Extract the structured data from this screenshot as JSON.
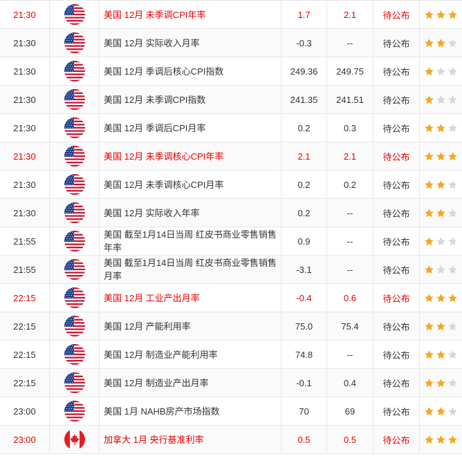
{
  "colors": {
    "important": "#e60000",
    "normal": "#333333",
    "star_on": "#f5a623",
    "star_off": "#d7d7d7"
  },
  "rows": [
    {
      "time": "21:30",
      "country": "us",
      "flag_icon": "us-flag-icon",
      "event": "美国 12月 未季调CPI年率",
      "previous": "1.7",
      "forecast": "2.1",
      "actual": "待公布",
      "stars": 3,
      "important": true
    },
    {
      "time": "21:30",
      "country": "us",
      "flag_icon": "us-flag-icon",
      "event": "美国 12月 实际收入月率",
      "previous": "-0.3",
      "forecast": "--",
      "actual": "待公布",
      "stars": 2,
      "important": false
    },
    {
      "time": "21:30",
      "country": "us",
      "flag_icon": "us-flag-icon",
      "event": "美国 12月 季调后核心CPI指数",
      "previous": "249.36",
      "forecast": "249.75",
      "actual": "待公布",
      "stars": 1,
      "important": false
    },
    {
      "time": "21:30",
      "country": "us",
      "flag_icon": "us-flag-icon",
      "event": "美国 12月 未季调CPI指数",
      "previous": "241.35",
      "forecast": "241.51",
      "actual": "待公布",
      "stars": 1,
      "important": false
    },
    {
      "time": "21:30",
      "country": "us",
      "flag_icon": "us-flag-icon",
      "event": "美国 12月 季调后CPI月率",
      "previous": "0.2",
      "forecast": "0.3",
      "actual": "待公布",
      "stars": 2,
      "important": false
    },
    {
      "time": "21:30",
      "country": "us",
      "flag_icon": "us-flag-icon",
      "event": "美国 12月 未季调核心CPI年率",
      "previous": "2.1",
      "forecast": "2.1",
      "actual": "待公布",
      "stars": 3,
      "important": true
    },
    {
      "time": "21:30",
      "country": "us",
      "flag_icon": "us-flag-icon",
      "event": "美国 12月 未季调核心CPI月率",
      "previous": "0.2",
      "forecast": "0.2",
      "actual": "待公布",
      "stars": 2,
      "important": false
    },
    {
      "time": "21:30",
      "country": "us",
      "flag_icon": "us-flag-icon",
      "event": "美国 12月 实际收入年率",
      "previous": "0.2",
      "forecast": "--",
      "actual": "待公布",
      "stars": 2,
      "important": false
    },
    {
      "time": "21:55",
      "country": "us",
      "flag_icon": "us-flag-icon",
      "event": "美国 截至1月14日当周 红皮书商业零售销售年率",
      "previous": "0.9",
      "forecast": "--",
      "actual": "待公布",
      "stars": 1,
      "important": false
    },
    {
      "time": "21:55",
      "country": "us",
      "flag_icon": "us-flag-icon",
      "event": "美国 截至1月14日当周 红皮书商业零售销售月率",
      "previous": "-3.1",
      "forecast": "--",
      "actual": "待公布",
      "stars": 1,
      "important": false
    },
    {
      "time": "22:15",
      "country": "us",
      "flag_icon": "us-flag-icon",
      "event": "美国 12月 工业产出月率",
      "previous": "-0.4",
      "forecast": "0.6",
      "actual": "待公布",
      "stars": 3,
      "important": true
    },
    {
      "time": "22:15",
      "country": "us",
      "flag_icon": "us-flag-icon",
      "event": "美国 12月 产能利用率",
      "previous": "75.0",
      "forecast": "75.4",
      "actual": "待公布",
      "stars": 2,
      "important": false
    },
    {
      "time": "22:15",
      "country": "us",
      "flag_icon": "us-flag-icon",
      "event": "美国 12月 制造业产能利用率",
      "previous": "74.8",
      "forecast": "--",
      "actual": "待公布",
      "stars": 2,
      "important": false
    },
    {
      "time": "22:15",
      "country": "us",
      "flag_icon": "us-flag-icon",
      "event": "美国 12月 制造业产出月率",
      "previous": "-0.1",
      "forecast": "0.4",
      "actual": "待公布",
      "stars": 2,
      "important": false
    },
    {
      "time": "23:00",
      "country": "us",
      "flag_icon": "us-flag-icon",
      "event": "美国 1月 NAHB房产市场指数",
      "previous": "70",
      "forecast": "69",
      "actual": "待公布",
      "stars": 2,
      "important": false
    },
    {
      "time": "23:00",
      "country": "ca",
      "flag_icon": "canada-flag-icon",
      "event": "加拿大 1月 央行基准利率",
      "previous": "0.5",
      "forecast": "0.5",
      "actual": "待公布",
      "stars": 3,
      "important": true
    }
  ]
}
